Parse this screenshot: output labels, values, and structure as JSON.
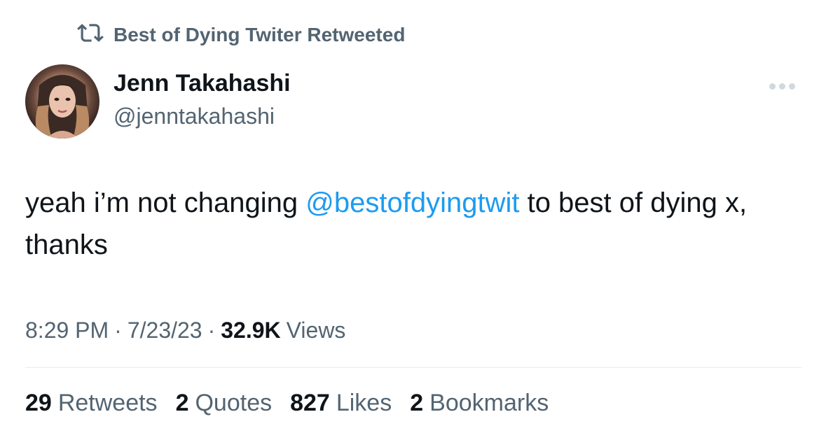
{
  "social_context": {
    "text": "Best of Dying Twiter Retweeted",
    "icon": "retweet-icon"
  },
  "author": {
    "name": "Jenn Takahashi",
    "handle": "@jenntakahashi",
    "avatar": "profile-photo"
  },
  "more_icon": "ellipsis-icon",
  "tweet": {
    "text_before": "yeah i’m not changing ",
    "mention": "@bestofdyingtwit",
    "text_after": " to best of dying x, thanks"
  },
  "meta": {
    "time": "8:29 PM",
    "separator": "·",
    "date": "7/23/23",
    "views_count": "32.9K",
    "views_label": "Views"
  },
  "stats": [
    {
      "count": "29",
      "label": "Retweets"
    },
    {
      "count": "2",
      "label": "Quotes"
    },
    {
      "count": "827",
      "label": "Likes"
    },
    {
      "count": "2",
      "label": "Bookmarks"
    }
  ],
  "colors": {
    "link": "#1d9bf0",
    "secondary_text": "#536471",
    "primary_text": "#0f1419",
    "divider": "#e6ecf0"
  }
}
